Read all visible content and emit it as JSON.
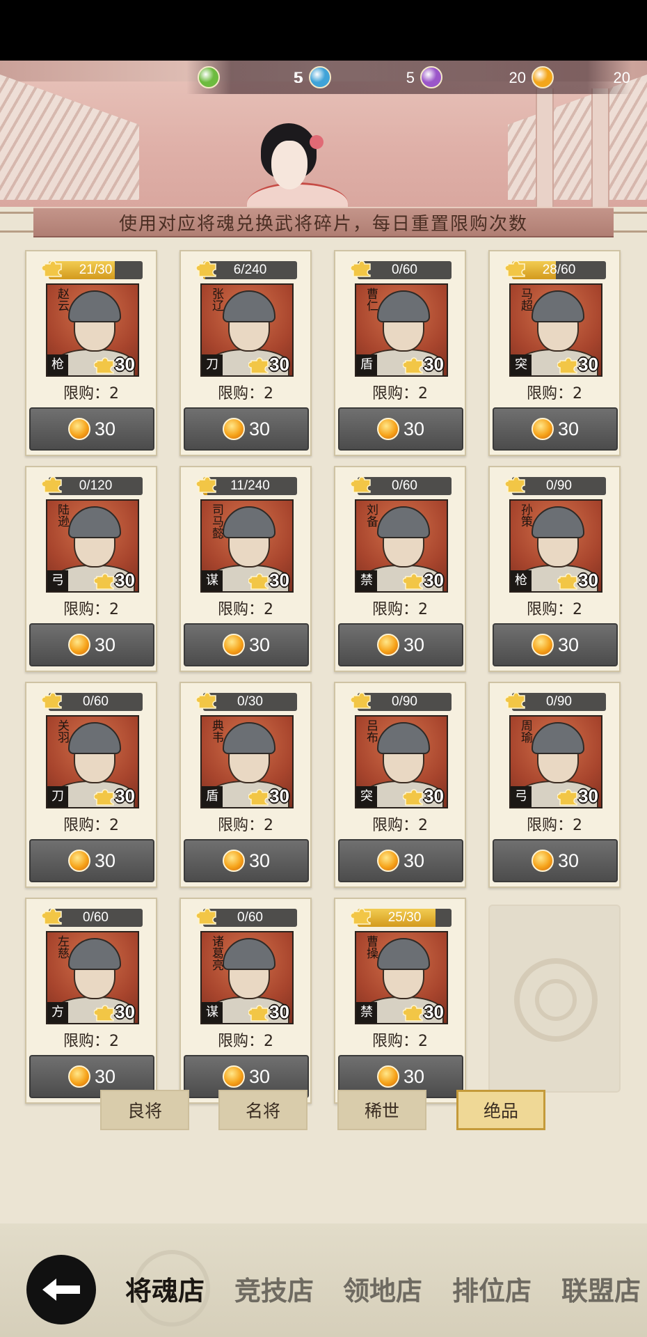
{
  "currency": [
    {
      "icon": "green-soul-orb-icon",
      "value": "5",
      "color": "#6dbb3f"
    },
    {
      "icon": "blue-soul-orb-icon",
      "value": "5",
      "color": "#3fa3d8"
    },
    {
      "icon": "purple-soul-orb-icon",
      "value": "5",
      "color": "#9a56c9"
    },
    {
      "icon": "gold-soul-orb-icon",
      "value": "20",
      "color": "#f3a61b"
    }
  ],
  "notice": "使用对应将魂兑换武将碎片，每日重置限购次数",
  "cards": [
    {
      "name": "赵云",
      "fragments": "21/30",
      "progress": 0.7,
      "type": "枪",
      "count": "30",
      "limit": "限购：2",
      "price": "30"
    },
    {
      "name": "张辽",
      "fragments": "6/240",
      "progress": 0.025,
      "type": "刀",
      "count": "30",
      "limit": "限购：2",
      "price": "30"
    },
    {
      "name": "曹仁",
      "fragments": "0/60",
      "progress": 0,
      "type": "盾",
      "count": "30",
      "limit": "限购：2",
      "price": "30"
    },
    {
      "name": "马超",
      "fragments": "28/60",
      "progress": 0.47,
      "type": "突",
      "count": "30",
      "limit": "限购：2",
      "price": "30"
    },
    {
      "name": "陆逊",
      "fragments": "0/120",
      "progress": 0,
      "type": "弓",
      "count": "30",
      "limit": "限购：2",
      "price": "30"
    },
    {
      "name": "司马懿",
      "fragments": "11/240",
      "progress": 0.046,
      "type": "谋",
      "count": "30",
      "limit": "限购：2",
      "price": "30"
    },
    {
      "name": "刘备",
      "fragments": "0/60",
      "progress": 0,
      "type": "禁",
      "count": "30",
      "limit": "限购：2",
      "price": "30"
    },
    {
      "name": "孙策",
      "fragments": "0/90",
      "progress": 0,
      "type": "枪",
      "count": "30",
      "limit": "限购：2",
      "price": "30"
    },
    {
      "name": "关羽",
      "fragments": "0/60",
      "progress": 0,
      "type": "刀",
      "count": "30",
      "limit": "限购：2",
      "price": "30"
    },
    {
      "name": "典韦",
      "fragments": "0/30",
      "progress": 0,
      "type": "盾",
      "count": "30",
      "limit": "限购：2",
      "price": "30"
    },
    {
      "name": "吕布",
      "fragments": "0/90",
      "progress": 0,
      "type": "突",
      "count": "30",
      "limit": "限购：2",
      "price": "30"
    },
    {
      "name": "周瑜",
      "fragments": "0/90",
      "progress": 0,
      "type": "弓",
      "count": "30",
      "limit": "限购：2",
      "price": "30"
    },
    {
      "name": "左慈",
      "fragments": "0/60",
      "progress": 0,
      "type": "方",
      "count": "30",
      "limit": "限购：2",
      "price": "30"
    },
    {
      "name": "诸葛亮",
      "fragments": "0/60",
      "progress": 0,
      "type": "谋",
      "count": "30",
      "limit": "限购：2",
      "price": "30"
    },
    {
      "name": "曹操",
      "fragments": "25/30",
      "progress": 0.83,
      "type": "禁",
      "count": "30",
      "limit": "限购：2",
      "price": "30"
    }
  ],
  "rarity_tabs": [
    {
      "label": "良将",
      "active": false
    },
    {
      "label": "名将",
      "active": false
    },
    {
      "label": "稀世",
      "active": false
    },
    {
      "label": "绝品",
      "active": true
    }
  ],
  "nav": [
    {
      "label": "将魂店",
      "active": true
    },
    {
      "label": "竞技店",
      "active": false
    },
    {
      "label": "领地店",
      "active": false
    },
    {
      "label": "排位店",
      "active": false
    },
    {
      "label": "联盟店",
      "active": false
    }
  ],
  "icons": {
    "back": "back-arrow-icon",
    "coin": "gold-coin-icon",
    "fragment": "puzzle-piece-icon"
  }
}
